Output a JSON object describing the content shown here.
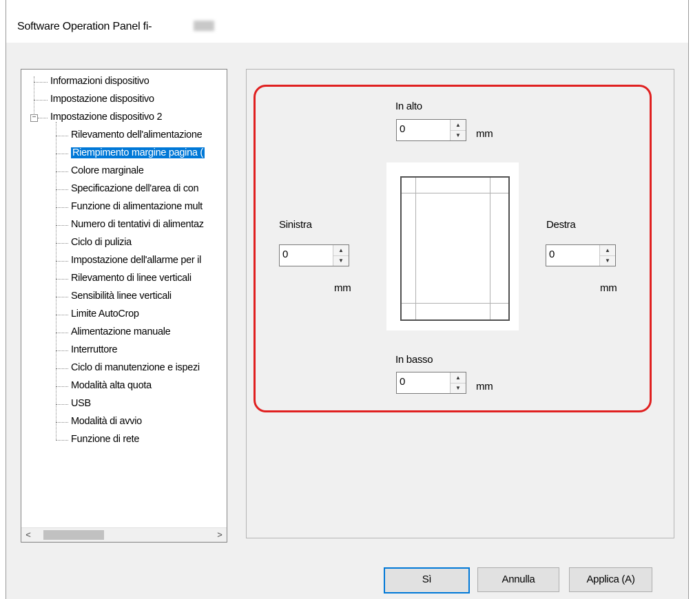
{
  "window": {
    "title": "Software Operation Panel fi-"
  },
  "tree": {
    "items": [
      {
        "label": "Informazioni dispositivo",
        "level": 0
      },
      {
        "label": "Impostazione dispositivo",
        "level": 0
      },
      {
        "label": "Impostazione dispositivo 2",
        "level": 0,
        "expanded": true
      },
      {
        "label": "Rilevamento dell'alimentazione",
        "level": 1
      },
      {
        "label": "Riempimento margine pagina (",
        "level": 1,
        "selected": true
      },
      {
        "label": "Colore marginale",
        "level": 1
      },
      {
        "label": "Specificazione dell'area di con",
        "level": 1
      },
      {
        "label": "Funzione di alimentazione mult",
        "level": 1
      },
      {
        "label": "Numero di tentativi di alimentaz",
        "level": 1
      },
      {
        "label": "Ciclo di pulizia",
        "level": 1
      },
      {
        "label": "Impostazione dell'allarme per il",
        "level": 1
      },
      {
        "label": "Rilevamento di linee verticali",
        "level": 1
      },
      {
        "label": "Sensibilità linee verticali",
        "level": 1
      },
      {
        "label": "Limite AutoCrop",
        "level": 1
      },
      {
        "label": "Alimentazione manuale",
        "level": 1
      },
      {
        "label": "Interruttore",
        "level": 1
      },
      {
        "label": "Ciclo di manutenzione e ispezi",
        "level": 1
      },
      {
        "label": "Modalità alta quota",
        "level": 1
      },
      {
        "label": "USB",
        "level": 1
      },
      {
        "label": "Modalità di avvio",
        "level": 1
      },
      {
        "label": "Funzione di rete",
        "level": 1
      }
    ],
    "scroll_left": "<",
    "scroll_right": ">"
  },
  "margins": {
    "top": {
      "label": "In alto",
      "value": "0",
      "unit": "mm"
    },
    "left": {
      "label": "Sinistra",
      "value": "0",
      "unit": "mm"
    },
    "right": {
      "label": "Destra",
      "value": "0",
      "unit": "mm"
    },
    "bottom": {
      "label": "In basso",
      "value": "0",
      "unit": "mm"
    }
  },
  "buttons": {
    "ok": "Sì",
    "cancel": "Annulla",
    "apply": "Applica (A)"
  },
  "colors": {
    "selection": "#0078d7",
    "highlight_border": "#e02020"
  }
}
